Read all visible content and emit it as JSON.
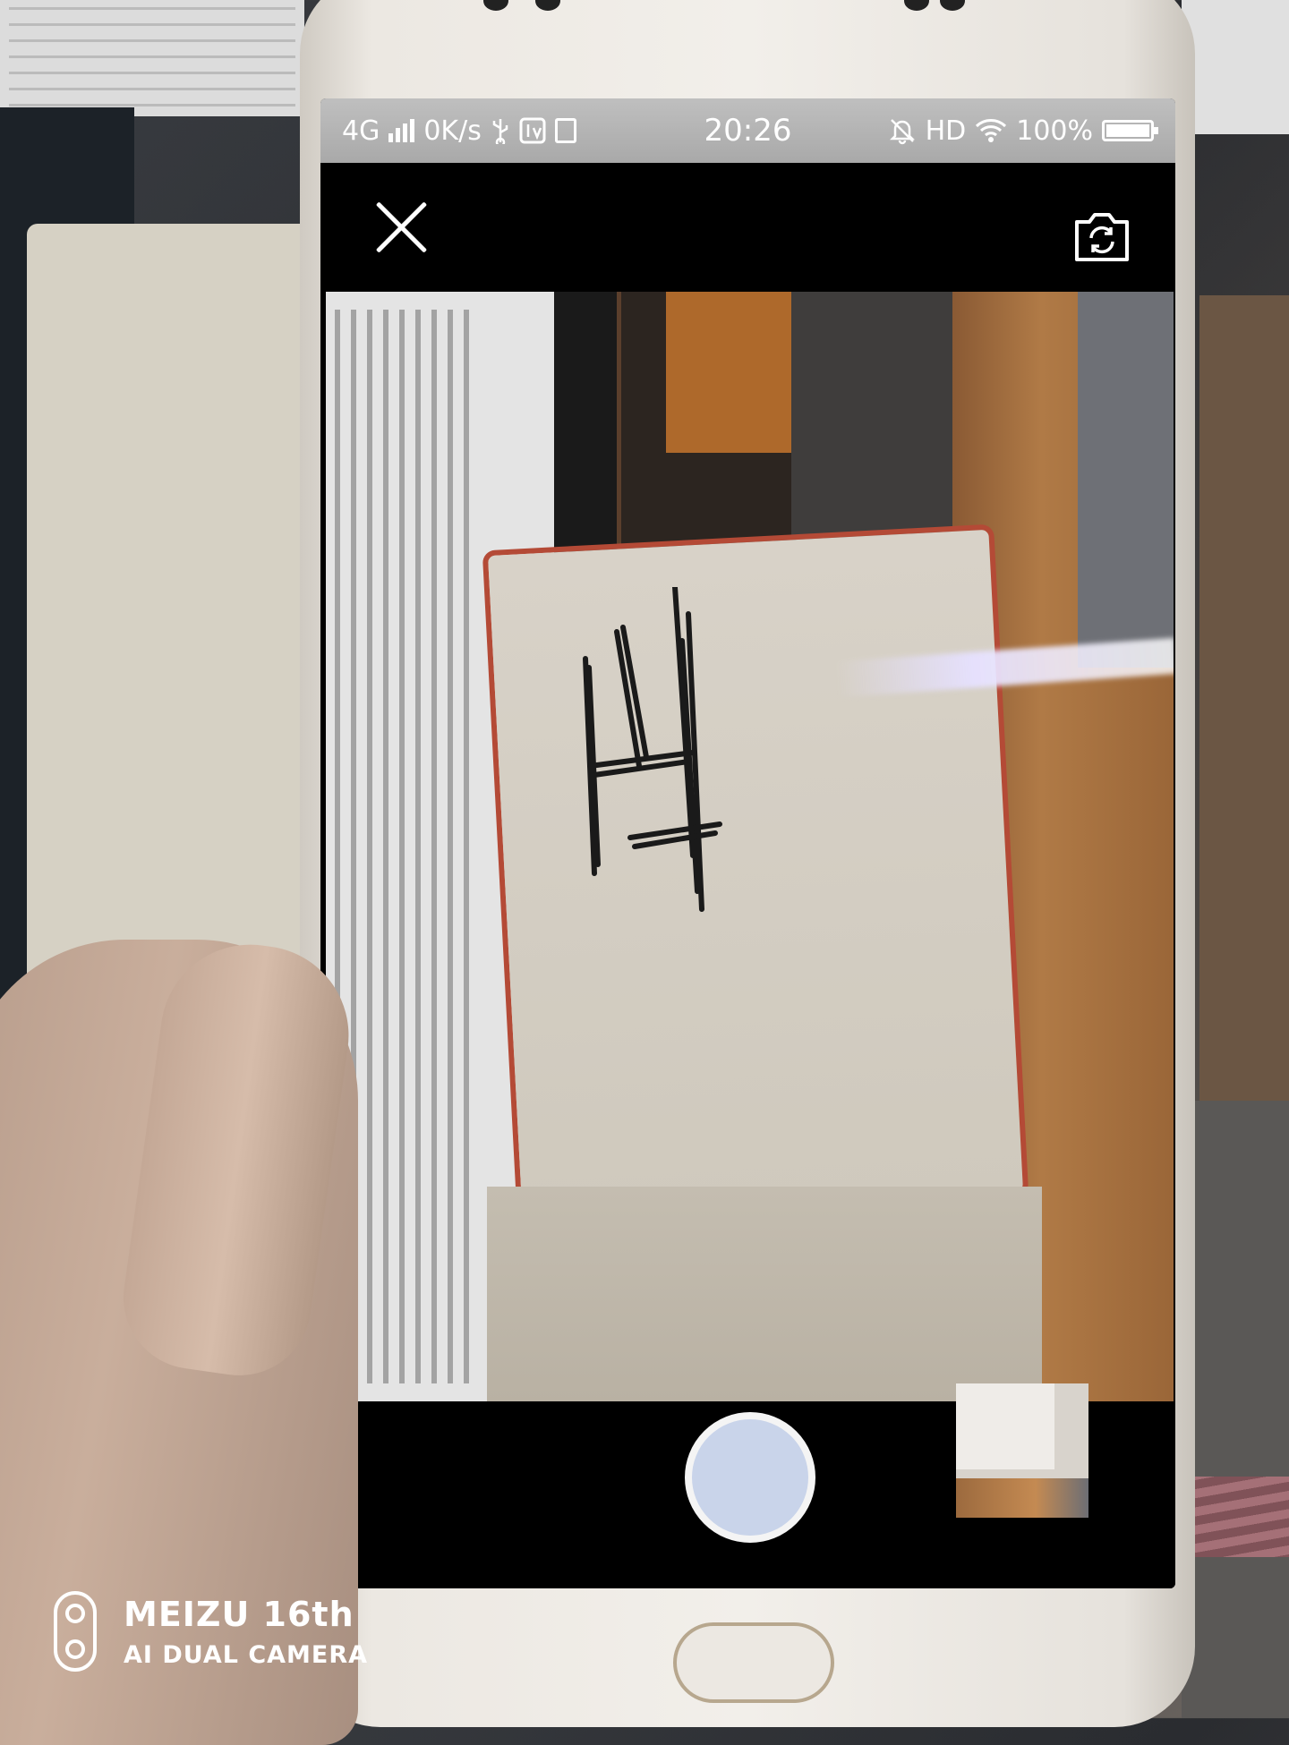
{
  "status_bar": {
    "network": "4G",
    "speed": "0K/s",
    "time": "20:26",
    "hd": "HD",
    "battery": "100%"
  },
  "camera": {
    "close_icon": "close-icon",
    "switch_icon": "camera-switch-icon",
    "shutter_color": "#c9d4ea"
  },
  "watermark": {
    "brand": "MEIZU 16th",
    "subtitle": "AI DUAL CAMERA"
  }
}
